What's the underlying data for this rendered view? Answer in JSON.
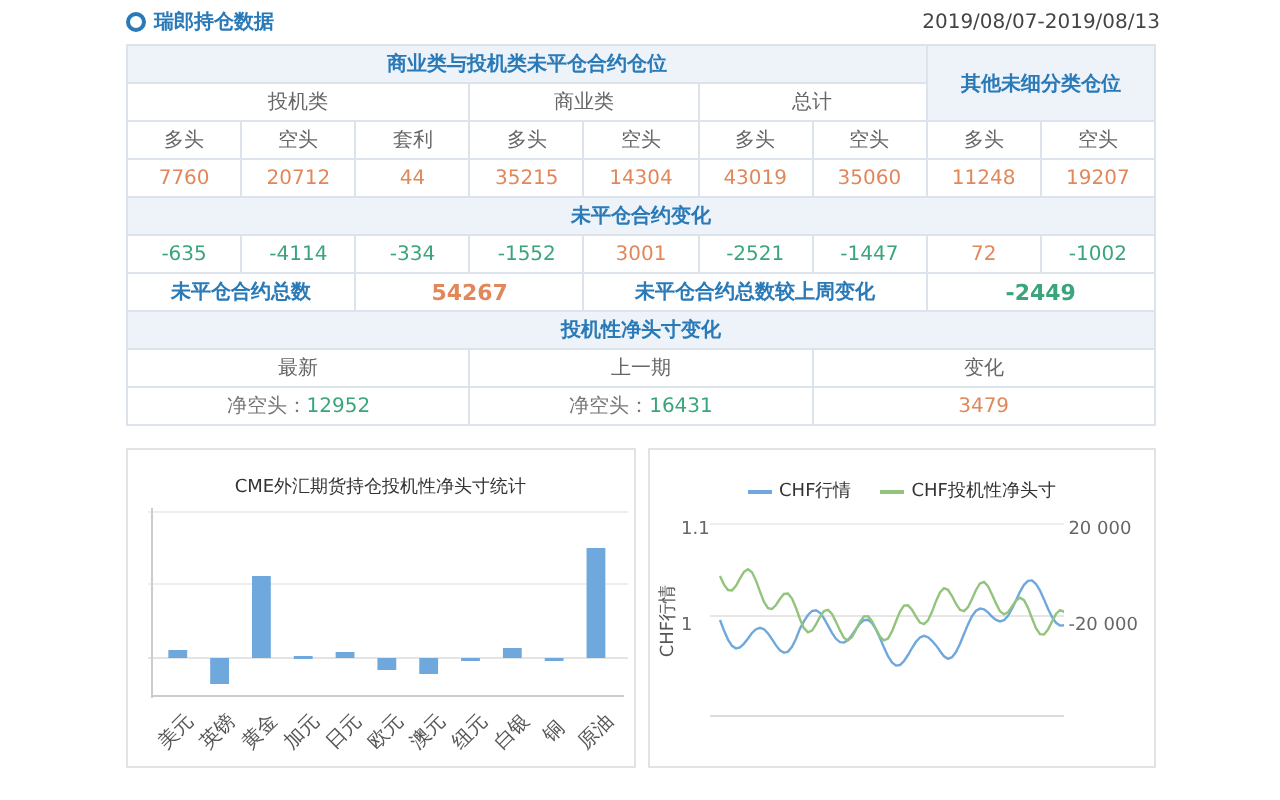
{
  "header": {
    "title": "瑞郎持仓数据",
    "date_range": "2019/08/07-2019/08/13"
  },
  "table": {
    "main_header": "商业类与投机类未平仓合约仓位",
    "other_header": "其他未细分类仓位",
    "group_headers": [
      "投机类",
      "商业类",
      "总计"
    ],
    "sub_headers": [
      "多头",
      "空头",
      "套利",
      "多头",
      "空头",
      "多头",
      "空头",
      "多头",
      "空头"
    ],
    "positions": [
      "7760",
      "20712",
      "44",
      "35215",
      "14304",
      "43019",
      "35060",
      "11248",
      "19207"
    ],
    "change_title": "未平仓合约变化",
    "changes": [
      {
        "value": "-635",
        "color": "#3aa57a"
      },
      {
        "value": "-4114",
        "color": "#3aa57a"
      },
      {
        "value": "-334",
        "color": "#3aa57a"
      },
      {
        "value": "-1552",
        "color": "#3aa57a"
      },
      {
        "value": "3001",
        "color": "#e2875a"
      },
      {
        "value": "-2521",
        "color": "#3aa57a"
      },
      {
        "value": "-1447",
        "color": "#3aa57a"
      },
      {
        "value": "72",
        "color": "#e2875a"
      },
      {
        "value": "-1002",
        "color": "#3aa57a"
      }
    ],
    "totals": [
      {
        "label": "未平仓合约总数",
        "value": "54267",
        "color": "#e2875a"
      },
      {
        "label": "未平仓合约总数较上周变化",
        "value": "-2449",
        "color": "#3aa57a"
      }
    ],
    "net_title": "投机性净头寸变化",
    "net_columns": [
      "最新",
      "上一期",
      "变化"
    ],
    "net_values": [
      {
        "label": "净空头：",
        "value": "12952",
        "color": "#3aa57a"
      },
      {
        "label": "净空头：",
        "value": "16431",
        "color": "#3aa57a"
      },
      {
        "value": "3479",
        "color": "#e2875a"
      }
    ]
  },
  "bar_chart": {
    "title": "CME外汇期货持仓投机性净头寸统计",
    "categories": [
      "美元",
      "英镑",
      "黄金",
      "加元",
      "日元",
      "欧元",
      "澳元",
      "纽元",
      "白银",
      "铜",
      "原油"
    ]
  },
  "line_chart": {
    "legend": [
      {
        "name": "CHF行情",
        "color": "#6fa8dc"
      },
      {
        "name": "CHF投机性净头寸",
        "color": "#93c47d"
      }
    ],
    "ylabel": "CHF行情",
    "left_ticks": [
      "1.1",
      "1"
    ],
    "right_ticks": [
      "20 000",
      "-20 000"
    ]
  }
}
